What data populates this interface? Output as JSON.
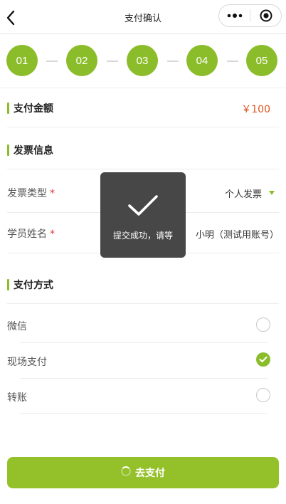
{
  "header": {
    "title": "支付确认"
  },
  "steps": [
    "01",
    "02",
    "03",
    "04",
    "05"
  ],
  "amount_section": {
    "title": "支付金额",
    "amount": "￥100"
  },
  "invoice_section": {
    "title": "发票信息",
    "fields": [
      {
        "label": "发票类型",
        "required_mark": "*",
        "value": "个人发票"
      },
      {
        "label": "学员姓名",
        "required_mark": "*",
        "value": "小明（测试用账号）"
      }
    ]
  },
  "payment_section": {
    "title": "支付方式",
    "options": [
      {
        "label": "微信",
        "selected": false
      },
      {
        "label": "现场支付",
        "selected": true
      },
      {
        "label": "转账",
        "selected": false
      }
    ]
  },
  "pay_button": {
    "label": "去支付"
  },
  "toast": {
    "text": "提交成功，请等"
  },
  "colors": {
    "accent": "#8bbd2b",
    "amount": "#e0551f",
    "required": "#e03b3b",
    "toast_bg": "#373737"
  },
  "icons": {
    "back": "chevron-left-icon",
    "more": "more-dots-icon",
    "close": "target-close-icon",
    "toast": "checkmark-icon",
    "selected_radio": "check-circle-icon",
    "dropdown": "caret-down-icon",
    "loading": "spinner-icon"
  }
}
